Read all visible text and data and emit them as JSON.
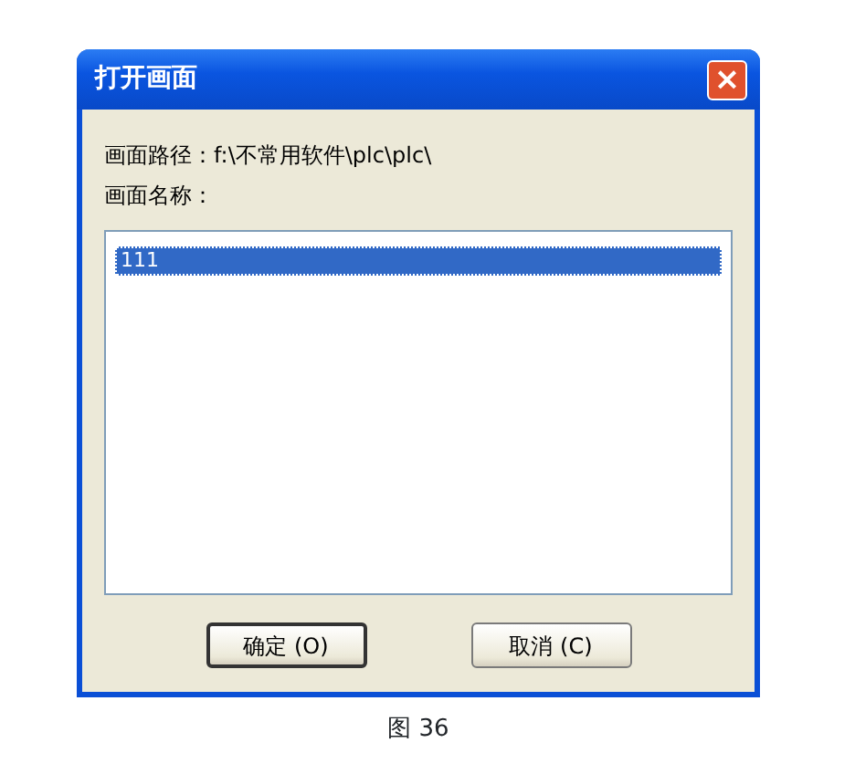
{
  "window": {
    "title": "打开画面",
    "close_button": "×"
  },
  "path_label": "画面路径：f:\\不常用软件\\plc\\plc\\",
  "name_label": "画面名称：",
  "list": [
    {
      "label": "111",
      "selected": true
    }
  ],
  "buttons": [
    {
      "label": "确定 (O)",
      "default": true
    },
    {
      "label": "取消 (C)",
      "default": false
    }
  ],
  "caption": "图 36"
}
